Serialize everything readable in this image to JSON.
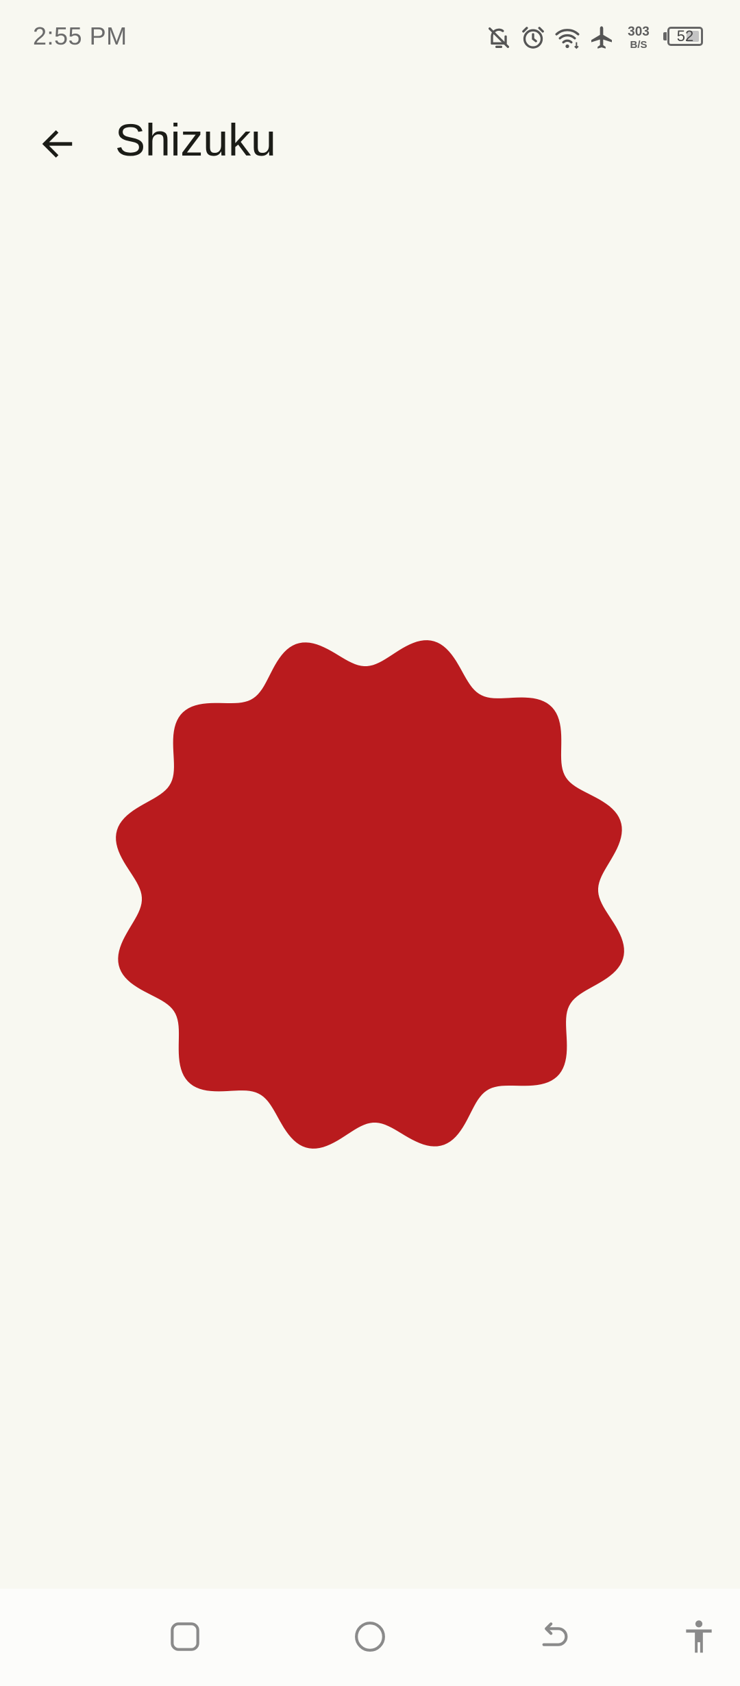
{
  "status_bar": {
    "time": "2:55 PM",
    "net_speed_value": "303",
    "net_speed_unit": "B/S",
    "battery_level": "52",
    "icons": [
      "notifications-off-icon",
      "alarm-icon",
      "wifi-icon",
      "airplane-mode-icon",
      "battery-icon"
    ]
  },
  "app_bar": {
    "title": "Shizuku",
    "back_icon": "arrow-left-icon"
  },
  "hero": {
    "shape": "wavy-circle",
    "color": "#b91b1e"
  },
  "nav_bar": {
    "buttons": [
      "recents-icon",
      "home-icon",
      "back-icon",
      "accessibility-icon"
    ]
  },
  "colors": {
    "background": "#f8f8f1",
    "accent": "#b91b1e",
    "text_primary": "#1b1c17"
  }
}
